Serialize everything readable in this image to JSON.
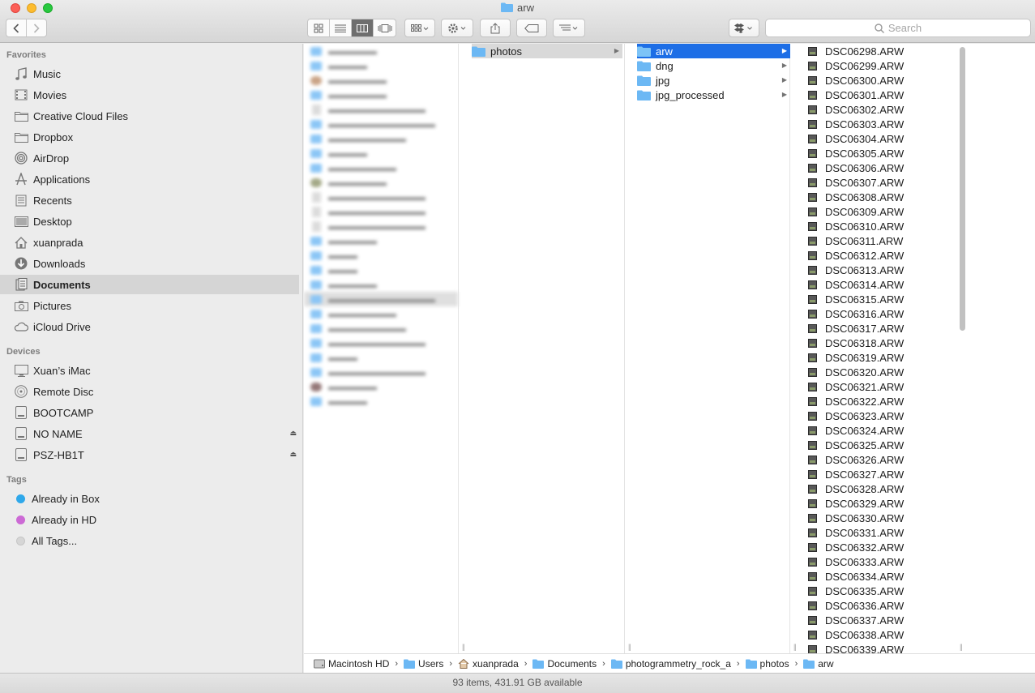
{
  "window": {
    "title": "arw"
  },
  "toolbar": {
    "back_icon": "chevron-left-icon",
    "forward_icon": "chevron-right-icon",
    "search_placeholder": "Search"
  },
  "sidebar": {
    "favorites_header": "Favorites",
    "favorites": [
      {
        "label": "Music",
        "icon": "music-icon"
      },
      {
        "label": "Movies",
        "icon": "movies-icon"
      },
      {
        "label": "Creative Cloud Files",
        "icon": "folder-icon"
      },
      {
        "label": "Dropbox",
        "icon": "folder-icon"
      },
      {
        "label": "AirDrop",
        "icon": "airdrop-icon"
      },
      {
        "label": "Applications",
        "icon": "applications-icon"
      },
      {
        "label": "Recents",
        "icon": "recents-icon"
      },
      {
        "label": "Desktop",
        "icon": "desktop-icon"
      },
      {
        "label": "xuanprada",
        "icon": "home-icon"
      },
      {
        "label": "Downloads",
        "icon": "downloads-icon"
      },
      {
        "label": "Documents",
        "icon": "documents-icon",
        "selected": true
      },
      {
        "label": "Pictures",
        "icon": "camera-icon"
      },
      {
        "label": "iCloud Drive",
        "icon": "cloud-icon"
      }
    ],
    "devices_header": "Devices",
    "devices": [
      {
        "label": "Xuan’s iMac",
        "icon": "imac-icon"
      },
      {
        "label": "Remote Disc",
        "icon": "disc-icon"
      },
      {
        "label": "BOOTCAMP",
        "icon": "drive-icon"
      },
      {
        "label": "NO NAME",
        "icon": "drive-icon",
        "eject": true
      },
      {
        "label": "PSZ-HB1T",
        "icon": "drive-icon",
        "eject": true
      }
    ],
    "tags_header": "Tags",
    "tags": [
      {
        "label": "Already in Box",
        "color": "#2fa8ea"
      },
      {
        "label": "Already in HD",
        "color": "#cc6ad5"
      },
      {
        "label": "All Tags...",
        "color": "#d6d6d6"
      }
    ]
  },
  "columns": {
    "column2": [
      {
        "label": "photos",
        "selected": true
      }
    ],
    "column3": [
      {
        "label": "arw",
        "selected": true
      },
      {
        "label": "dng"
      },
      {
        "label": "jpg"
      },
      {
        "label": "jpg_processed"
      }
    ],
    "files": [
      "DSC06298.ARW",
      "DSC06299.ARW",
      "DSC06300.ARW",
      "DSC06301.ARW",
      "DSC06302.ARW",
      "DSC06303.ARW",
      "DSC06304.ARW",
      "DSC06305.ARW",
      "DSC06306.ARW",
      "DSC06307.ARW",
      "DSC06308.ARW",
      "DSC06309.ARW",
      "DSC06310.ARW",
      "DSC06311.ARW",
      "DSC06312.ARW",
      "DSC06313.ARW",
      "DSC06314.ARW",
      "DSC06315.ARW",
      "DSC06316.ARW",
      "DSC06317.ARW",
      "DSC06318.ARW",
      "DSC06319.ARW",
      "DSC06320.ARW",
      "DSC06321.ARW",
      "DSC06322.ARW",
      "DSC06323.ARW",
      "DSC06324.ARW",
      "DSC06325.ARW",
      "DSC06326.ARW",
      "DSC06327.ARW",
      "DSC06328.ARW",
      "DSC06329.ARW",
      "DSC06330.ARW",
      "DSC06331.ARW",
      "DSC06332.ARW",
      "DSC06333.ARW",
      "DSC06334.ARW",
      "DSC06335.ARW",
      "DSC06336.ARW",
      "DSC06337.ARW",
      "DSC06338.ARW",
      "DSC06339.ARW"
    ]
  },
  "pathbar": [
    {
      "label": "Macintosh HD",
      "icon": "drive-icon"
    },
    {
      "label": "Users",
      "icon": "folder-icon"
    },
    {
      "label": "xuanprada",
      "icon": "home-icon"
    },
    {
      "label": "Documents",
      "icon": "folder-icon"
    },
    {
      "label": "photogrammetry_rock_a",
      "icon": "folder-icon"
    },
    {
      "label": "photos",
      "icon": "folder-icon"
    },
    {
      "label": "arw",
      "icon": "folder-icon"
    }
  ],
  "status": {
    "text": "93 items, 431.91 GB available"
  },
  "colors": {
    "selection_blue": "#1d6ee6",
    "folder_blue": "#6cb8f4"
  }
}
